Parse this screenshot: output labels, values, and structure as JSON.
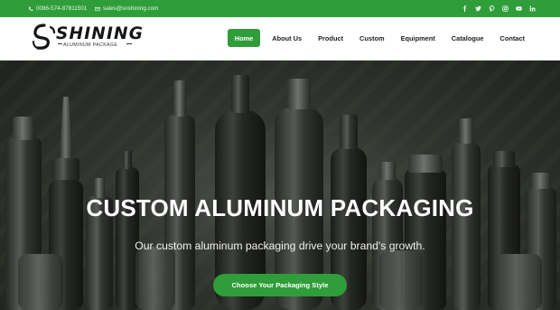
{
  "topbar": {
    "phone": "0086-574-87811501",
    "email": "sales@snshining.com",
    "socials": [
      {
        "name": "facebook-icon"
      },
      {
        "name": "twitter-icon"
      },
      {
        "name": "pinterest-icon"
      },
      {
        "name": "instagram-icon"
      },
      {
        "name": "youtube-icon"
      },
      {
        "name": "linkedin-icon"
      }
    ]
  },
  "logo": {
    "brand": "SHINING",
    "tagline": "ALUMINUM PACKAGE"
  },
  "nav": {
    "items": [
      {
        "label": "Home",
        "active": true
      },
      {
        "label": "About Us"
      },
      {
        "label": "Product"
      },
      {
        "label": "Custom"
      },
      {
        "label": "Equipment"
      },
      {
        "label": "Catalogue"
      },
      {
        "label": "Contact"
      }
    ]
  },
  "hero": {
    "title": "CUSTOM ALUMINUM PACKAGING",
    "subtitle": "Our custom aluminum packaging drive your brand's growth.",
    "cta_label": "Choose Your Packaging Style"
  },
  "colors": {
    "brand_green": "#2f9d3a",
    "header_bg": "#ffffff",
    "hero_dark": "#242623"
  }
}
